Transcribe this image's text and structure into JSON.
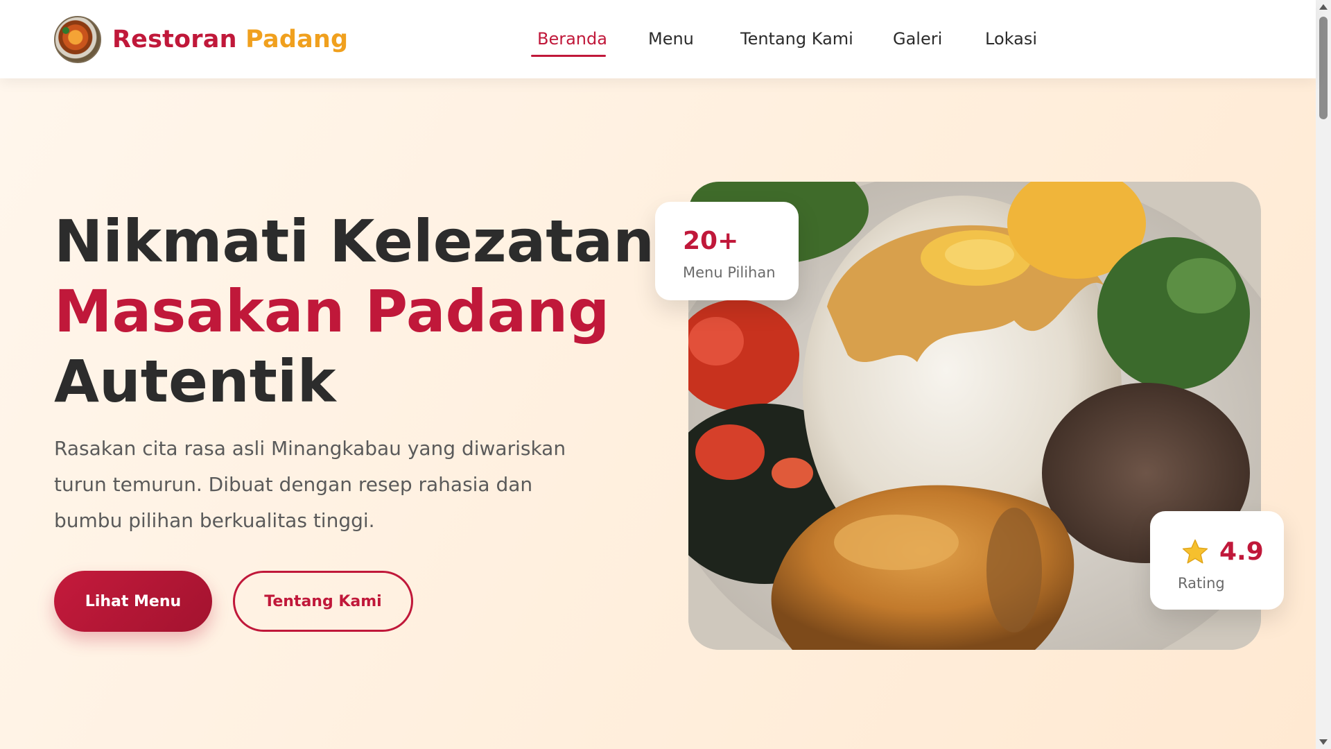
{
  "brand": {
    "name_part1": "Restoran",
    "name_part2": "Padang",
    "logo_icon": "food-plate-logo-icon"
  },
  "nav": {
    "items": [
      {
        "label": "Beranda",
        "active": true
      },
      {
        "label": "Menu",
        "active": false
      },
      {
        "label": "Tentang Kami",
        "active": false
      },
      {
        "label": "Galeri",
        "active": false
      },
      {
        "label": "Lokasi",
        "active": false
      }
    ]
  },
  "hero": {
    "title_line1": "Nikmati Kelezatan",
    "title_line2": "Masakan Padang",
    "title_line3": "Autentik",
    "description": "Rasakan cita rasa asli Minangkabau yang diwariskan turun temurun. Dibuat dengan resep rahasia dan bumbu pilihan berkualitas tinggi.",
    "primary_button": "Lihat Menu",
    "secondary_button": "Tentang Kami"
  },
  "stats": {
    "menu_count": "20+",
    "menu_label": "Menu Pilihan",
    "rating_value": "4.9",
    "rating_label": "Rating",
    "rating_icon": "star-icon"
  },
  "colors": {
    "primary": "#c0183a",
    "accent": "#f0a01e",
    "text_dark": "#2c2c2c",
    "hero_bg": "#fff3e6"
  }
}
